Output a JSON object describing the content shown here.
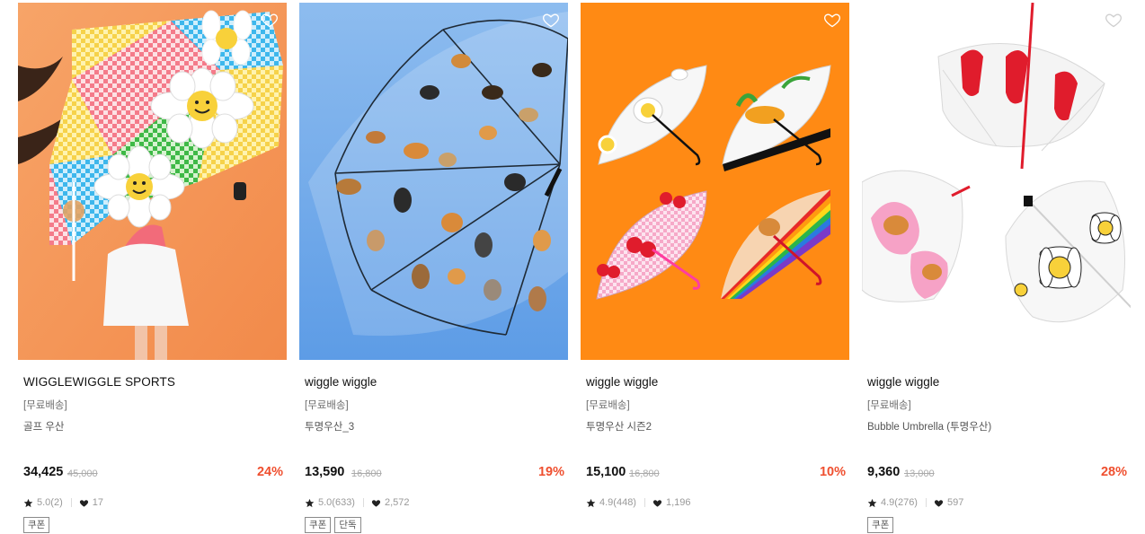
{
  "products": [
    {
      "brand": "WIGGLEWIGGLE SPORTS",
      "tag": "[무료배송]",
      "name": "골프 우산",
      "price": "34,425",
      "original_price": "45,000",
      "discount": "24%",
      "rating": "5.0(2)",
      "likes": "17",
      "badges": [
        "쿠폰"
      ]
    },
    {
      "brand": "wiggle wiggle",
      "tag": "[무료배송]",
      "name": "투명우산_3",
      "price": "13,590",
      "original_price": "16,800",
      "discount": "19%",
      "rating": "5.0(633)",
      "likes": "2,572",
      "badges": [
        "쿠폰",
        "단독"
      ]
    },
    {
      "brand": "wiggle wiggle",
      "tag": "[무료배송]",
      "name": "투명우산 시즌2",
      "price": "15,100",
      "original_price": "16,800",
      "discount": "10%",
      "rating": "4.9(448)",
      "likes": "1,196",
      "badges": []
    },
    {
      "brand": "wiggle wiggle",
      "tag": "[무료배송]",
      "name": "Bubble Umbrella (투명우산)",
      "price": "9,360",
      "original_price": "13,000",
      "discount": "28%",
      "rating": "4.9(276)",
      "likes": "597",
      "badges": [
        "쿠폰"
      ]
    }
  ],
  "icons": {
    "wishlist": "heart-outline-icon",
    "rating": "star-icon",
    "likes": "heart-filled-icon"
  },
  "colors": {
    "discount": "#ef4f2f",
    "text": "#111111",
    "muted": "#999999"
  }
}
